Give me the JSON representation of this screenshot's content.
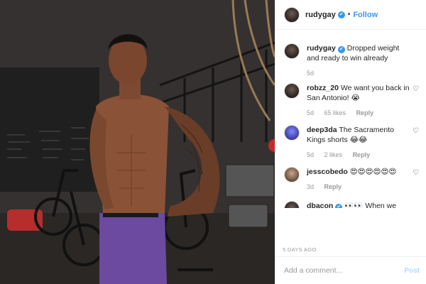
{
  "post": {
    "username": "rudygay",
    "follow_label": "Follow",
    "timestamp": "5 DAYS AGO",
    "verified_mark": "✔"
  },
  "comments": [
    {
      "user": "rudygay",
      "text": "Dropped weight and ready to win already",
      "age": "5d",
      "likes": "",
      "reply": "",
      "verified": true
    },
    {
      "user": "robzz_20",
      "text": "We want you back in San Antonio! 😭",
      "age": "5d",
      "likes": "65 likes",
      "reply": "Reply"
    },
    {
      "user": "deep3da",
      "text": "The Sacramento Kings shorts 😂😂",
      "age": "5d",
      "likes": "2 likes",
      "reply": "Reply"
    },
    {
      "user": "jesscobedo",
      "text": "😍😍😍😍😍😍",
      "age": "3d",
      "likes": "",
      "reply": "Reply"
    },
    {
      "user": "dbacon",
      "text": "👀👀 When we",
      "age": "",
      "likes": "",
      "reply": "",
      "verified": true
    }
  ],
  "add_comment": {
    "placeholder": "Add a comment...",
    "post_label": "Post"
  },
  "icons": {
    "heart": "heart-outline-icon",
    "verified": "verified-badge-icon"
  },
  "colors": {
    "accent": "#3897f0",
    "muted": "#999999",
    "border": "#efefef"
  }
}
